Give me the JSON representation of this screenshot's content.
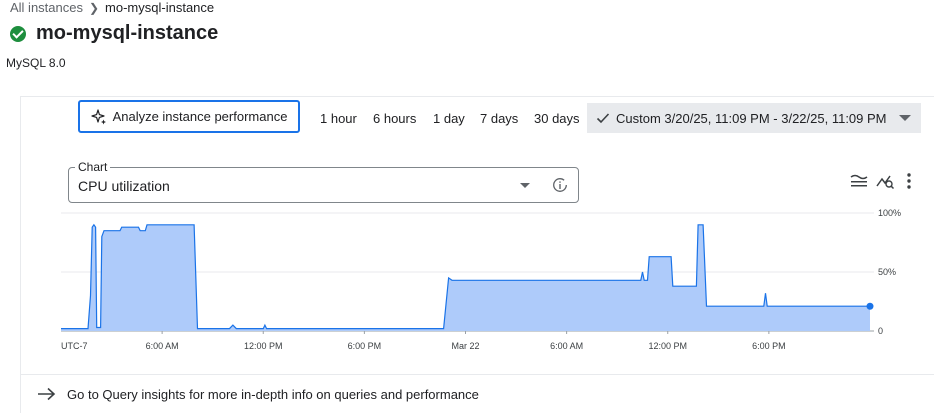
{
  "breadcrumb": {
    "parent": "All instances",
    "current": "mo-mysql-instance"
  },
  "instance": {
    "name": "mo-mysql-instance",
    "version": "MySQL 8.0",
    "status_icon": "check-circle-icon"
  },
  "toolbar": {
    "analyze_label": "Analyze instance performance",
    "ranges": [
      "1 hour",
      "6 hours",
      "1 day",
      "7 days",
      "30 days"
    ],
    "custom_label": "Custom 3/20/25, 11:09 PM - 3/22/25, 11:09 PM"
  },
  "chart_select": {
    "label": "Chart",
    "value": "CPU utilization"
  },
  "chart_data": {
    "type": "area",
    "title": "",
    "xlabel": "",
    "ylabel": "",
    "y_unit": "%",
    "ylim": [
      0,
      100
    ],
    "y_ticks": [
      "100%",
      "50%",
      "0"
    ],
    "x_ticks": [
      "UTC-7",
      "6:00 AM",
      "12:00 PM",
      "6:00 PM",
      "Mar 22",
      "6:00 AM",
      "12:00 PM",
      "6:00 PM"
    ],
    "x_hours_range": [
      0,
      48
    ],
    "series": [
      {
        "color": "#1a73e8",
        "fill": "#aecbfa",
        "points": [
          [
            0.0,
            2
          ],
          [
            1.0,
            2
          ],
          [
            1.6,
            2
          ],
          [
            1.75,
            30
          ],
          [
            1.85,
            88
          ],
          [
            1.95,
            90
          ],
          [
            2.05,
            88
          ],
          [
            2.12,
            3
          ],
          [
            2.35,
            3
          ],
          [
            2.42,
            80
          ],
          [
            2.55,
            85
          ],
          [
            3.5,
            85
          ],
          [
            3.6,
            88
          ],
          [
            4.6,
            88
          ],
          [
            4.7,
            85
          ],
          [
            5.0,
            85
          ],
          [
            5.1,
            90
          ],
          [
            7.9,
            90
          ],
          [
            8.1,
            2
          ],
          [
            10.0,
            2
          ],
          [
            10.2,
            5
          ],
          [
            10.4,
            2
          ],
          [
            12.0,
            2
          ],
          [
            12.1,
            5
          ],
          [
            12.2,
            2
          ],
          [
            22.7,
            2
          ],
          [
            23.0,
            45
          ],
          [
            23.2,
            43
          ],
          [
            34.4,
            43
          ],
          [
            34.5,
            50
          ],
          [
            34.6,
            43
          ],
          [
            34.8,
            43
          ],
          [
            34.9,
            63
          ],
          [
            36.2,
            63
          ],
          [
            36.3,
            38
          ],
          [
            37.7,
            38
          ],
          [
            37.8,
            90
          ],
          [
            38.1,
            90
          ],
          [
            38.3,
            21
          ],
          [
            41.7,
            21
          ],
          [
            41.8,
            32
          ],
          [
            41.9,
            21
          ],
          [
            48.0,
            21
          ]
        ]
      }
    ],
    "current_point": [
      48.0,
      21
    ]
  },
  "footer": {
    "link_text": "Go to Query insights for more in-depth info on queries and performance"
  }
}
